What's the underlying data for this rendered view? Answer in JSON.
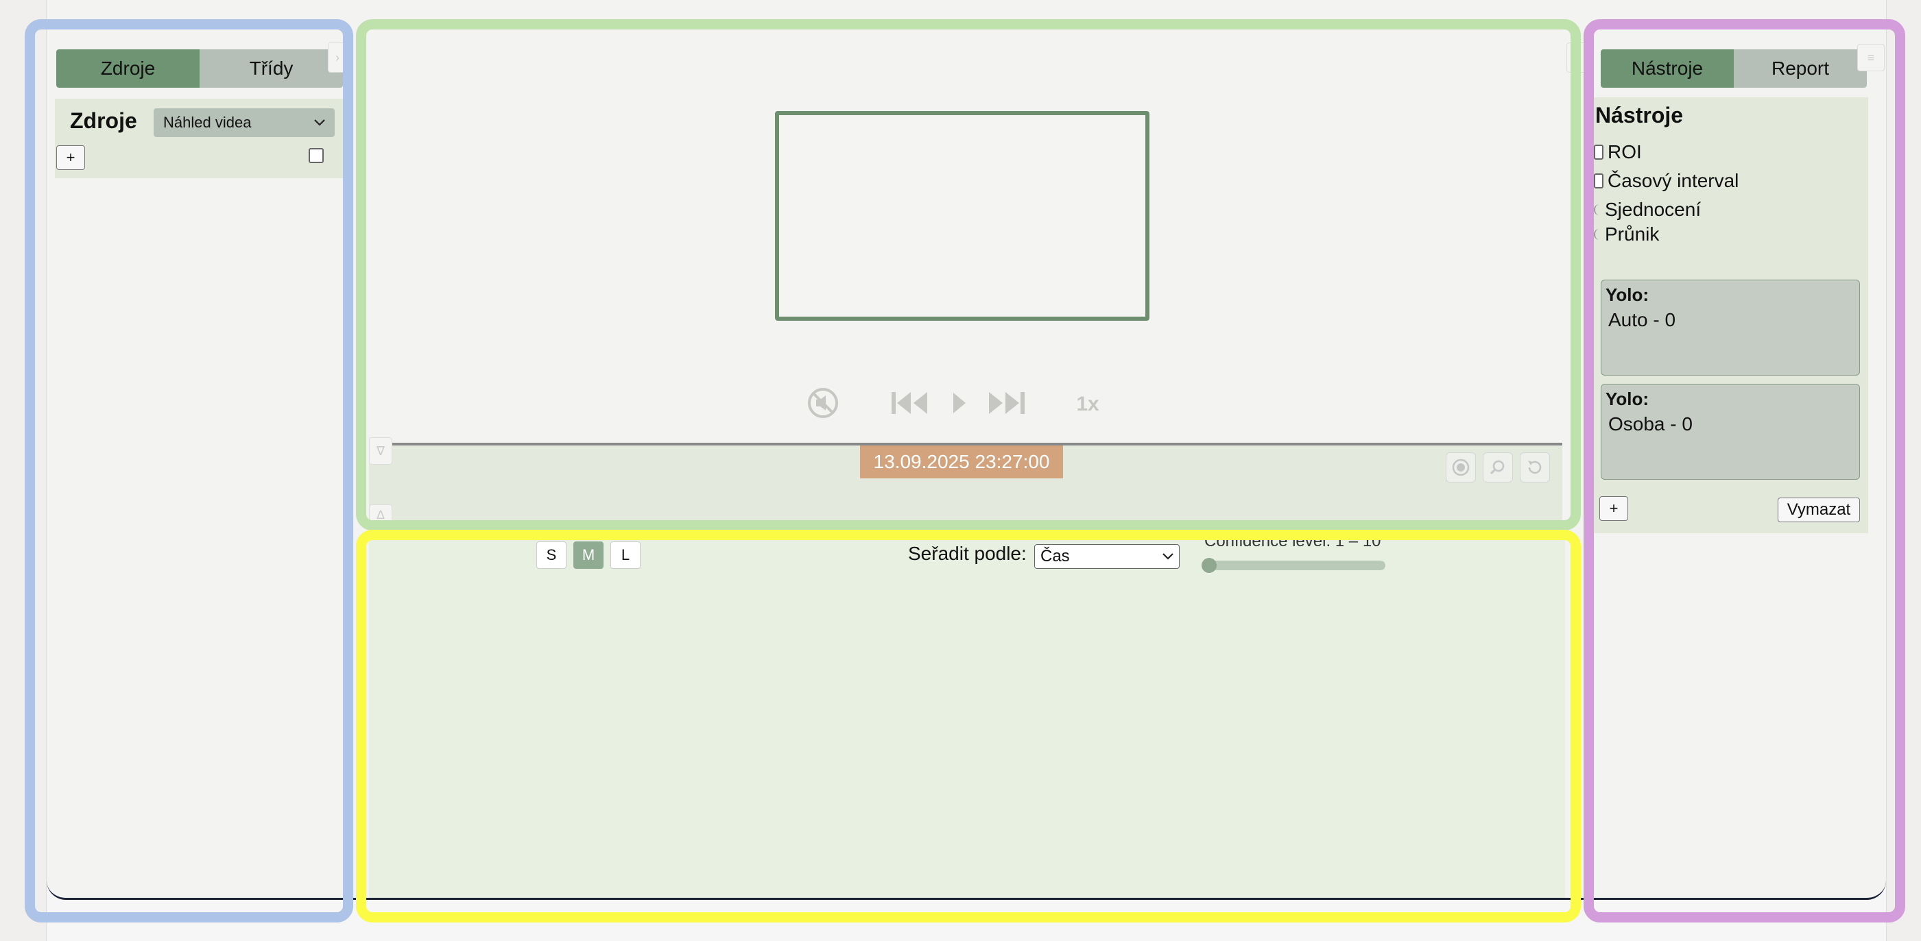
{
  "left_panel": {
    "tabs": [
      {
        "label": "Zdroje",
        "active": true
      },
      {
        "label": "Třídy",
        "active": false
      }
    ],
    "title": "Zdroje",
    "source_select": "Náhled videa",
    "add_label": "+"
  },
  "video": {
    "speed": "1x",
    "timestamp": "13.09.2025 23:27:00"
  },
  "results": {
    "sizes": [
      {
        "label": "S",
        "active": false
      },
      {
        "label": "M",
        "active": true
      },
      {
        "label": "L",
        "active": false
      }
    ],
    "sort_label": "Seřadit podle:",
    "sort_value": "Čas",
    "confidence_label": "Confidence level: 1 – 10",
    "confidence_min": 1,
    "confidence_max": 10,
    "confidence_value": 1
  },
  "right_panel": {
    "tabs": [
      {
        "label": "Nástroje",
        "active": true
      },
      {
        "label": "Report",
        "active": false
      }
    ],
    "title": "Nástroje",
    "tools": [
      {
        "label": "ROI",
        "kind": "checkbox"
      },
      {
        "label": "Časový interval",
        "kind": "checkbox"
      },
      {
        "label": "Sjednocení",
        "kind": "radio"
      },
      {
        "label": "Průnik",
        "kind": "radio"
      }
    ],
    "cards": [
      {
        "title": "Yolo:",
        "value": "Auto - 0"
      },
      {
        "title": "Yolo:",
        "value": "Osoba - 0"
      }
    ],
    "add_label": "+",
    "clear_label": "Vymazat"
  },
  "colors": {
    "highlight_left": "#adc3e7",
    "highlight_video": "#bfe2ad",
    "highlight_results": "#fbfb45",
    "highlight_right": "#d39cdb",
    "accent_green": "#6f9473",
    "timestamp_bg": "#d2a37d"
  }
}
